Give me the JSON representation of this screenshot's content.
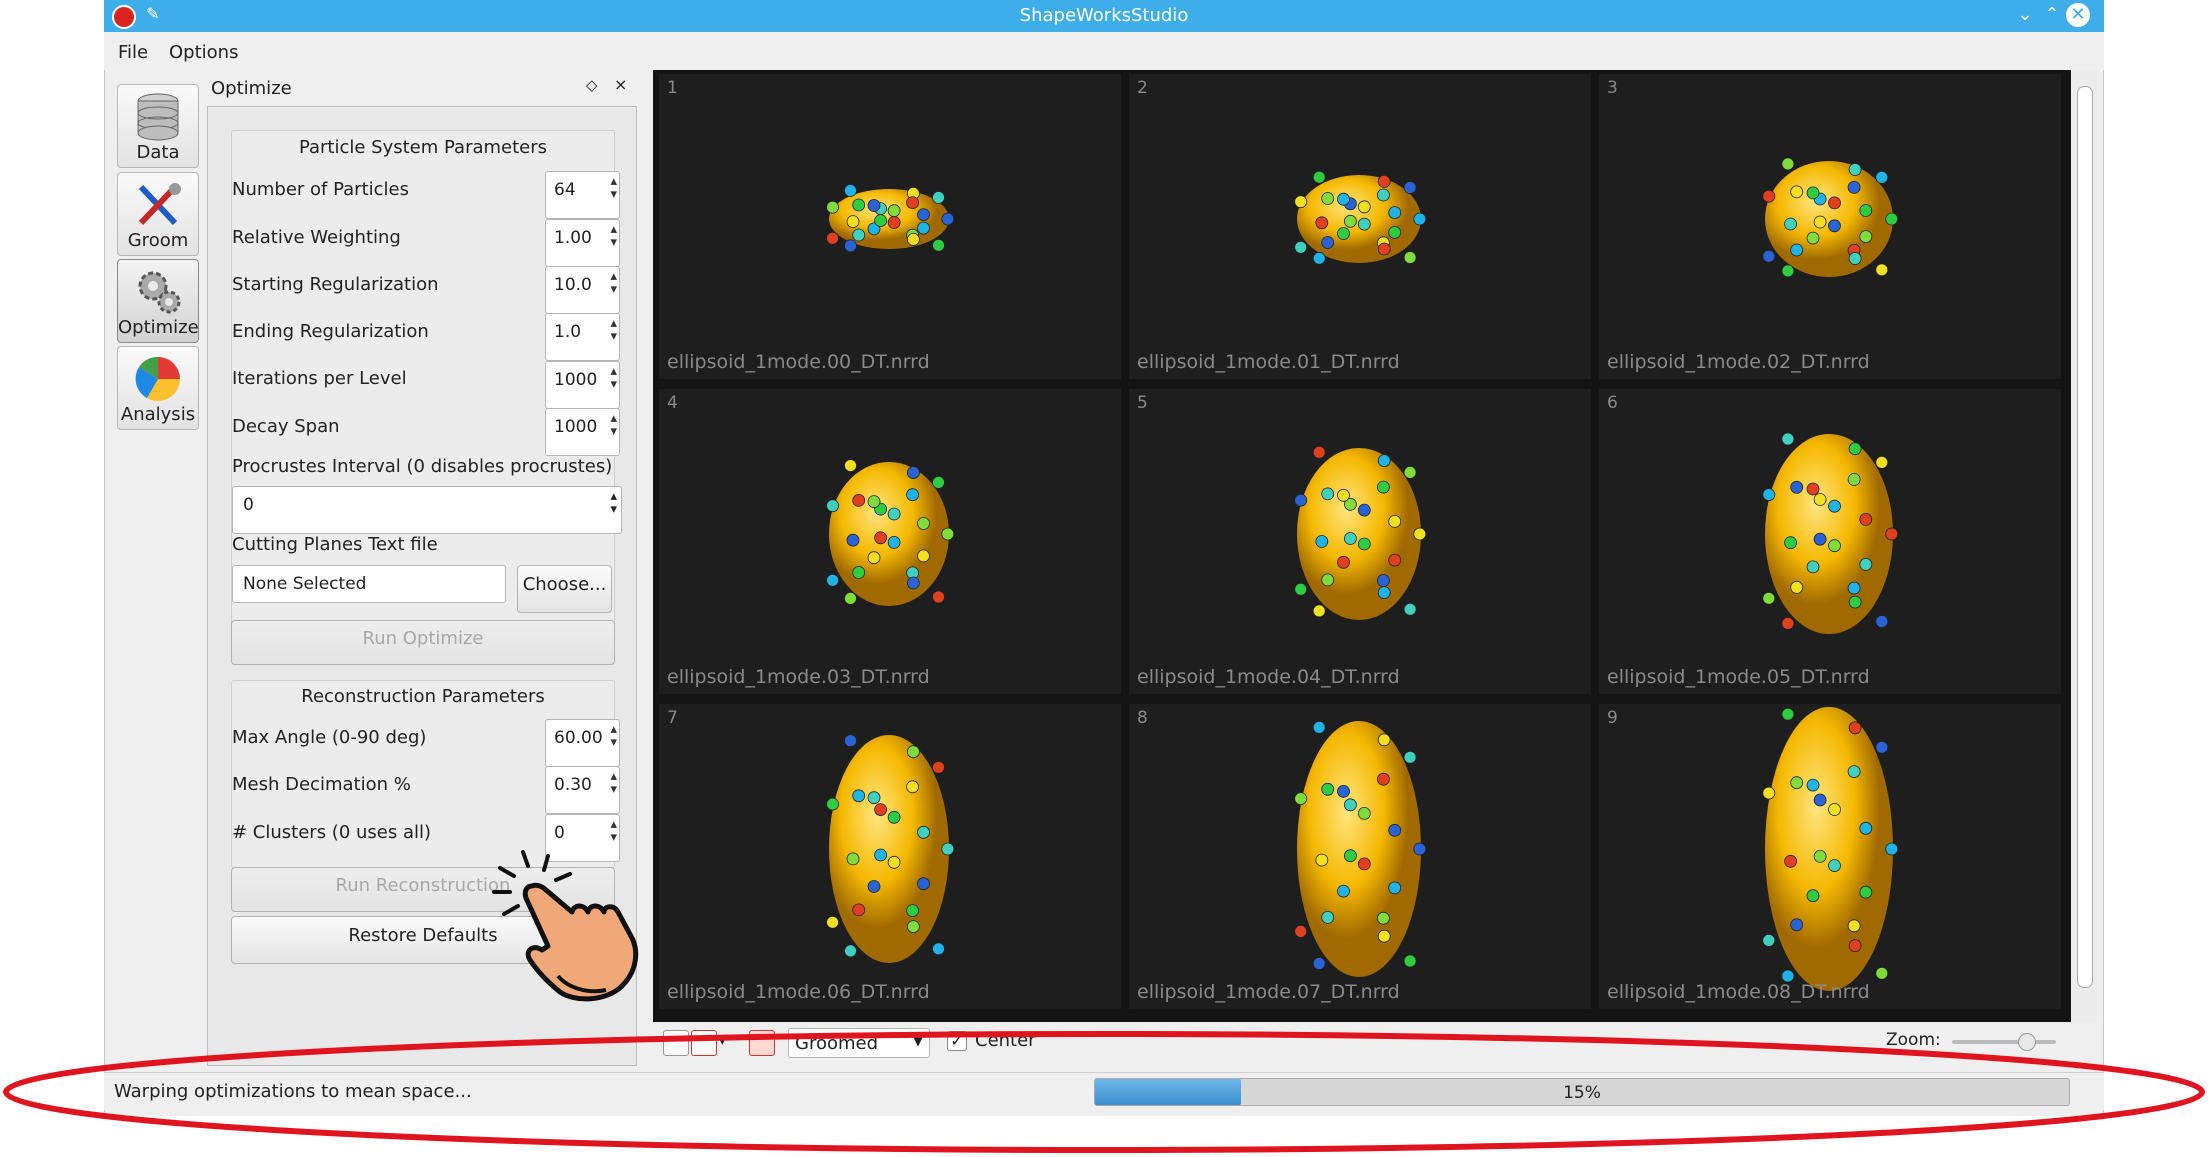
{
  "window": {
    "title": "ShapeWorksStudio"
  },
  "menu": [
    "File",
    "Options"
  ],
  "tools": [
    {
      "label": "Data",
      "icon": "database-icon"
    },
    {
      "label": "Groom",
      "icon": "tools-icon"
    },
    {
      "label": "Optimize",
      "icon": "gears-icon"
    },
    {
      "label": "Analysis",
      "icon": "pie-chart-icon"
    }
  ],
  "dock": {
    "title": "Optimize",
    "particle_group": {
      "title": "Particle System Parameters",
      "params": [
        {
          "label": "Number of Particles",
          "value": "64"
        },
        {
          "label": "Relative Weighting",
          "value": "1.00"
        },
        {
          "label": "Starting Regularization",
          "value": "10.0"
        },
        {
          "label": "Ending Regularization",
          "value": "1.0"
        },
        {
          "label": "Iterations per Level",
          "value": "1000"
        },
        {
          "label": "Decay Span",
          "value": "1000"
        }
      ],
      "procrustes_label": "Procrustes Interval (0 disables procrustes)",
      "procrustes_value": "0",
      "cutting_planes_label": "Cutting Planes Text file",
      "cutting_planes_value": "None Selected",
      "choose_button": "Choose...",
      "run_button": "Run Optimize"
    },
    "reconstruction_group": {
      "title": "Reconstruction Parameters",
      "params": [
        {
          "label": "Max Angle (0-90 deg)",
          "value": "60.00"
        },
        {
          "label": "Mesh Decimation %",
          "value": "0.30"
        },
        {
          "label": "# Clusters (0 uses all)",
          "value": "0"
        }
      ],
      "run_button": "Run Reconstruction",
      "restore_button": "Restore Defaults"
    }
  },
  "viewer": {
    "cells": [
      {
        "index": "1",
        "file": "ellipsoid_1mode.00_DT.nrrd"
      },
      {
        "index": "2",
        "file": "ellipsoid_1mode.01_DT.nrrd"
      },
      {
        "index": "3",
        "file": "ellipsoid_1mode.02_DT.nrrd"
      },
      {
        "index": "4",
        "file": "ellipsoid_1mode.03_DT.nrrd"
      },
      {
        "index": "5",
        "file": "ellipsoid_1mode.04_DT.nrrd"
      },
      {
        "index": "6",
        "file": "ellipsoid_1mode.05_DT.nrrd"
      },
      {
        "index": "7",
        "file": "ellipsoid_1mode.06_DT.nrrd"
      },
      {
        "index": "8",
        "file": "ellipsoid_1mode.07_DT.nrrd"
      },
      {
        "index": "9",
        "file": "ellipsoid_1mode.08_DT.nrrd"
      }
    ],
    "view_mode": "Groomed",
    "center_label": "Center",
    "center_checked": true,
    "zoom_label": "Zoom:"
  },
  "status": {
    "message": "Warping optimizations to mean space...",
    "progress": 15,
    "progress_text": "15%"
  },
  "colors": {
    "titlebar": "#3daee9",
    "surface": "#f5b800",
    "highlight_ring": "#e0141e",
    "hand": "#f0a878"
  }
}
